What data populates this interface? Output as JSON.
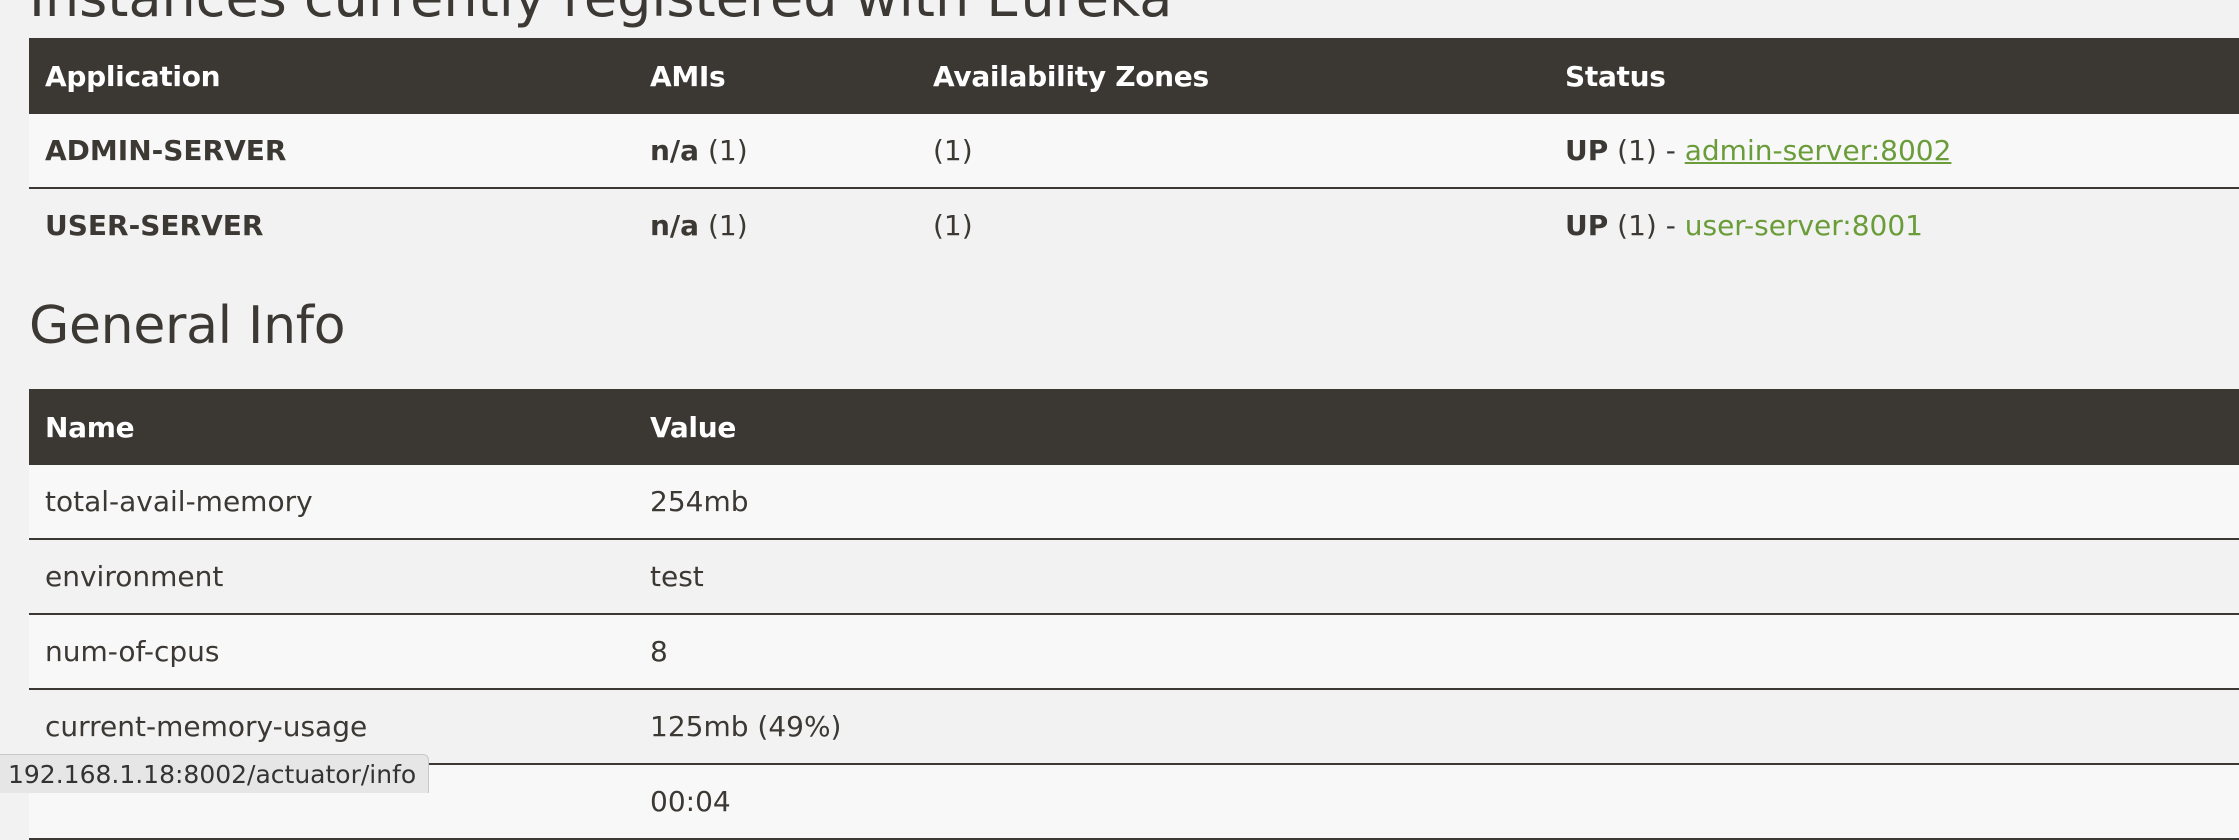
{
  "instances_heading": "Instances currently registered with Eureka",
  "apps_table": {
    "headers": [
      "Application",
      "AMIs",
      "Availability Zones",
      "Status"
    ],
    "rows": [
      {
        "application": "ADMIN-SERVER",
        "ami_bold": "n/a",
        "ami_count": "(1)",
        "zones": "(1)",
        "status_bold": "UP",
        "status_count": "(1) -",
        "link": "admin-server:8002"
      },
      {
        "application": "USER-SERVER",
        "ami_bold": "n/a",
        "ami_count": "(1)",
        "zones": "(1)",
        "status_bold": "UP",
        "status_count": "(1) -",
        "link": "user-server:8001"
      }
    ]
  },
  "general_info": {
    "title": "General Info",
    "headers": [
      "Name",
      "Value"
    ],
    "rows": [
      {
        "name": "total-avail-memory",
        "value": "254mb"
      },
      {
        "name": "environment",
        "value": "test"
      },
      {
        "name": "num-of-cpus",
        "value": "8"
      },
      {
        "name": "current-memory-usage",
        "value": "125mb (49%)"
      },
      {
        "name": "",
        "value": "00:04"
      }
    ]
  },
  "status_bar": {
    "url": "192.168.1.18:8002/actuator/info"
  },
  "colors": {
    "header_bg": "#3b3834",
    "link": "#6a9c3a",
    "page_bg": "#f2f2f2"
  }
}
